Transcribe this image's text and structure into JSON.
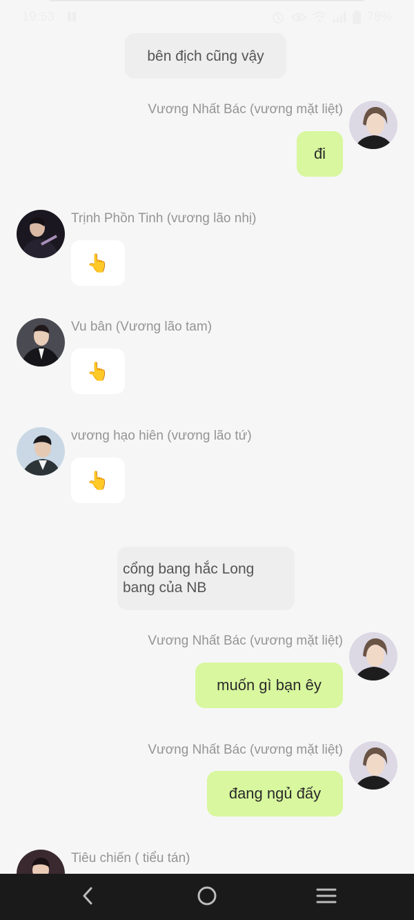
{
  "status_bar": {
    "time": "19:53",
    "battery": "78%"
  },
  "messages": [
    {
      "kind": "system",
      "text": "bên địch cũng vậy"
    },
    {
      "kind": "outgoing",
      "sender": "Vương Nhất Bác (vương mặt liệt)",
      "text": "đi"
    },
    {
      "kind": "incoming",
      "sender": "Trịnh Phồn Tinh (vương lão nhị)",
      "text": "👆"
    },
    {
      "kind": "incoming",
      "sender": "Vu bân (Vương lão tam)",
      "text": "👆"
    },
    {
      "kind": "incoming",
      "sender": "vương hạo hiên (vương lão tứ)",
      "text": "👆"
    },
    {
      "kind": "system",
      "text": "cổng bang hắc Long\n bang của NB"
    },
    {
      "kind": "outgoing",
      "sender": "Vương Nhất Bác (vương mặt liệt)",
      "text": "muốn gì bạn êy"
    },
    {
      "kind": "outgoing",
      "sender": "Vương Nhất Bác (vương mặt liệt)",
      "text": "đang ngủ đấy"
    },
    {
      "kind": "incoming",
      "sender": "Tiêu chiến ( tiểu tán)",
      "text": ""
    }
  ],
  "icons": {
    "back": "back-chevron-icon",
    "home": "home-circle-icon",
    "menu": "menu-lines-icon"
  },
  "colors": {
    "background": "#f6f6f6",
    "outgoing_bubble": "#d8f79e",
    "incoming_bubble": "#ffffff",
    "system_bubble": "#eeeeee",
    "sender_name": "#949494",
    "nav_bar": "#1a1a1a"
  }
}
